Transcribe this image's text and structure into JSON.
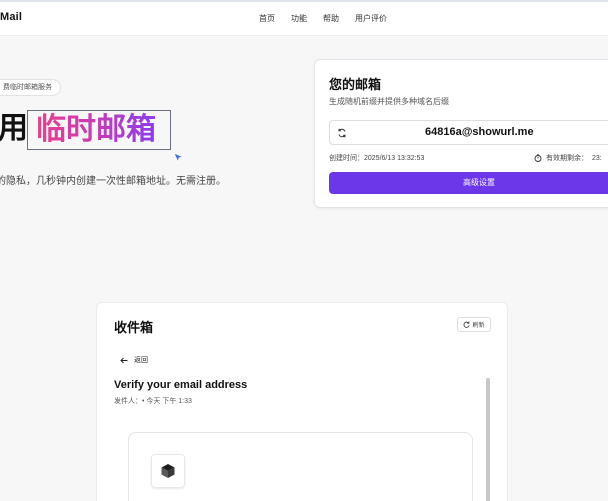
{
  "header": {
    "logo": "Mail",
    "nav": [
      "首页",
      "功能",
      "帮助",
      "用户评价"
    ]
  },
  "hero": {
    "badge": "费临时邮箱服务",
    "title_prefix": "用",
    "title_highlight": "临时邮箱",
    "subtitle": "的隐私，几秒钟内创建一次性邮箱地址。无需注册。"
  },
  "mailbox": {
    "title": "您的邮箱",
    "subtitle": "生成随机前缀并提供多种域名后缀",
    "address": "64816a@showurl.me",
    "created_label": "创建时间：2025/6/13 13:32:53",
    "expire_label": "有效期剩余：",
    "expire_value": "23:",
    "advanced_button": "高级设置"
  },
  "inbox": {
    "title": "收件箱",
    "refresh_label": "刷新",
    "back_label": "返回",
    "subject": "Verify your email address",
    "meta": "发件人：• 今天 下午 1:33"
  },
  "colors": {
    "accent": "#6c37e8",
    "gradient_start": "#ec3d8d",
    "gradient_end": "#8b3cf0"
  },
  "icons": [
    "refresh-icon",
    "timer-icon",
    "arrow-left-icon",
    "cube-logo-icon",
    "cursor-pointer-icon"
  ]
}
